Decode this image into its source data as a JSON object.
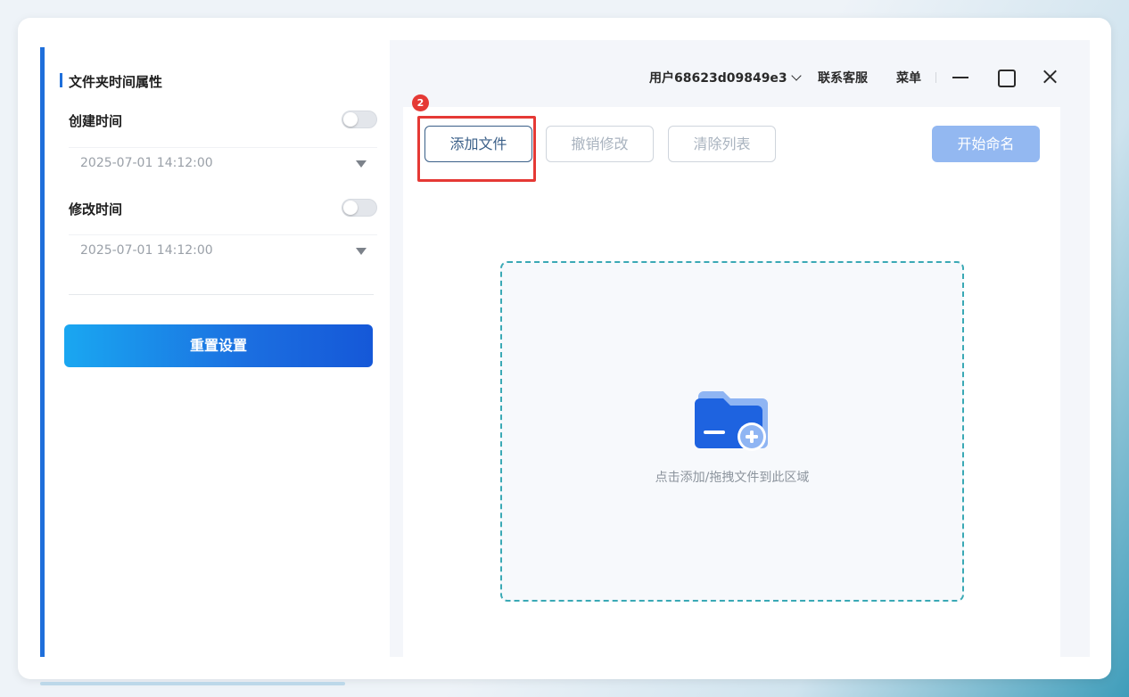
{
  "sidebar": {
    "section_title": "文件夹时间属性",
    "created": {
      "label": "创建时间",
      "value": "2025-07-01 14:12:00",
      "enabled": false
    },
    "modified": {
      "label": "修改时间",
      "value": "2025-07-01 14:12:00",
      "enabled": false
    },
    "reset_label": "重置设置"
  },
  "topbar": {
    "user_label": "用户68623d09849e3",
    "support_label": "联系客服",
    "menu_label": "菜单"
  },
  "toolbar": {
    "add_files_label": "添加文件",
    "undo_label": "撤销修改",
    "clear_label": "清除列表",
    "start_label": "开始命名"
  },
  "annotation": {
    "step_number": "2"
  },
  "dropzone": {
    "hint": "点击添加/拖拽文件到此区域"
  },
  "colors": {
    "accent": "#1f6fdb",
    "highlight": "#e53935",
    "start_button": "#93b8f1"
  }
}
